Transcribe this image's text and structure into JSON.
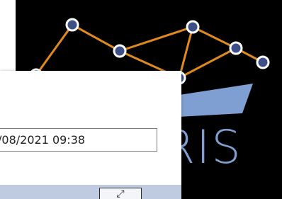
{
  "datetime_field": {
    "value": "/08/2021 09:38"
  },
  "logo": {
    "text": "RIS",
    "network_icon": "network-graph-icon",
    "ship_icon": "ship-icon",
    "colors": {
      "line": "#e08a1e",
      "node": "#3c4f86",
      "node_outline": "#ffffff",
      "ship": "#7f9fd2",
      "text": "#7f9fd2",
      "background": "#000000"
    }
  },
  "expand_button": {
    "icon": "expand-icon",
    "glyph": "⤢"
  }
}
